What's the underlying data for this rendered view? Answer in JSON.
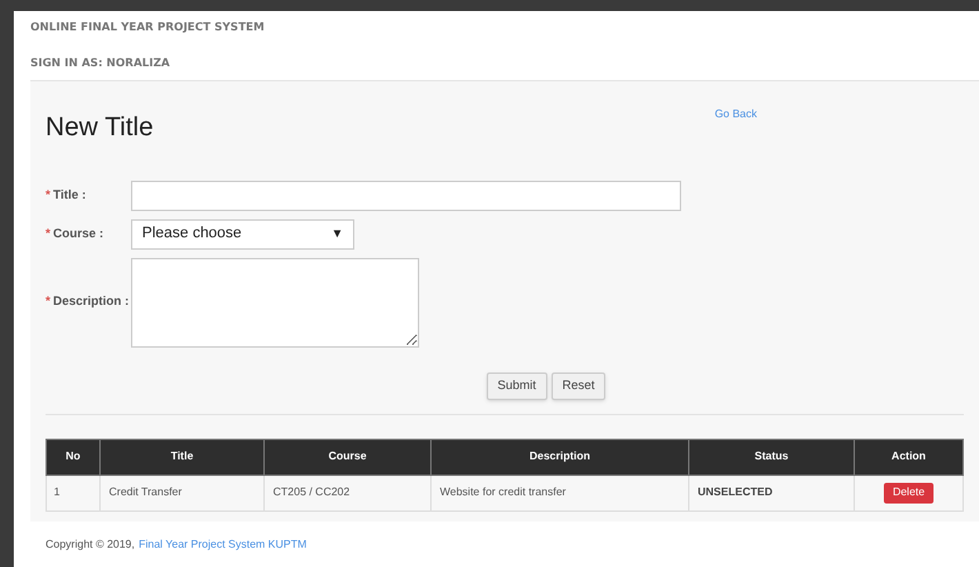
{
  "header": {
    "system_name": "ONLINE FINAL YEAR PROJECT SYSTEM",
    "signed_in": "SIGN IN AS: NORALIZA"
  },
  "panel": {
    "title": "New Title",
    "back_link": "Go Back"
  },
  "form": {
    "fields": [
      {
        "kind": "text",
        "required_mark": "*",
        "label": "Title :"
      },
      {
        "kind": "select",
        "required_mark": "*",
        "label": "Course :",
        "value": "Please choose",
        "arrow": "▼"
      },
      {
        "kind": "textarea",
        "required_mark": "*",
        "label": "Description :"
      }
    ],
    "buttons": [
      "Submit",
      "Reset"
    ]
  },
  "table": {
    "columns": [
      "No",
      "Title",
      "Course",
      "Description",
      "Status",
      "Action"
    ],
    "rows": [
      {
        "no": "1",
        "title": "Credit Transfer",
        "course": "CT205 / CC202",
        "description": "Website for credit transfer",
        "status": "UNSELECTED",
        "action": "Delete"
      }
    ]
  },
  "footer": {
    "copyright": "Copyright © 2019,",
    "link": "Final Year Project System KUPTM"
  }
}
